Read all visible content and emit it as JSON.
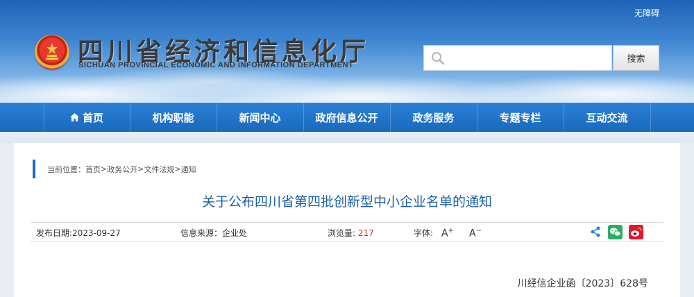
{
  "header": {
    "accessibility_link": "无障碍",
    "org_name_cn": "四川省经济和信息化厅",
    "org_name_en": "SICHUAN PROVINCIAL ECONOMIC AND INFORMATION DEPARTMENT",
    "search": {
      "value": "",
      "placeholder": "",
      "button_label": "搜索"
    }
  },
  "nav": {
    "items": [
      {
        "label": "首页",
        "icon": "home-icon"
      },
      {
        "label": "机构职能"
      },
      {
        "label": "新闻中心"
      },
      {
        "label": "政府信息公开"
      },
      {
        "label": "政务服务"
      },
      {
        "label": "专题专栏"
      },
      {
        "label": "互动交流"
      }
    ]
  },
  "breadcrumb": {
    "prefix": "当前位置：",
    "items": [
      "首页",
      "政务公开",
      "文件法规",
      "通知"
    ],
    "separator": ">"
  },
  "article": {
    "title": "关于公布四川省第四批创新型中小企业名单的通知",
    "publish_date_label": "发布日期:",
    "publish_date": "2023-09-27",
    "source_label": "信息来源：",
    "source": "企业处",
    "views_label": "浏览量:",
    "views": "217",
    "font_label": "字体:",
    "font_larger": "A",
    "font_smaller": "A",
    "doc_number": "川经信企业函〔2023〕628号"
  },
  "share": {
    "icons": [
      "share-icon",
      "wechat-icon",
      "weibo-icon"
    ]
  },
  "colors": {
    "nav_blue": "#1a69bd",
    "title_blue": "#1a5fa6",
    "views_red": "#c8332b",
    "wechat_green": "#2aae67",
    "weibo_red": "#e6162d"
  }
}
